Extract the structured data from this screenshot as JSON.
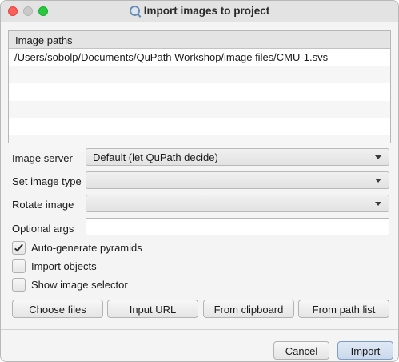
{
  "window": {
    "title": "Import images to project"
  },
  "image_paths": {
    "header": "Image paths",
    "rows": [
      "/Users/sobolp/Documents/QuPath Workshop/image files/CMU-1.svs",
      "",
      "",
      "",
      "",
      ""
    ]
  },
  "form": {
    "image_server": {
      "label": "Image server",
      "value": "Default (let QuPath decide)"
    },
    "image_type": {
      "label": "Set image type",
      "value": ""
    },
    "rotate": {
      "label": "Rotate image",
      "value": ""
    },
    "optional_args": {
      "label": "Optional args",
      "value": ""
    }
  },
  "options": {
    "pyramids": {
      "label": "Auto-generate pyramids",
      "checked": true
    },
    "objects": {
      "label": "Import objects",
      "checked": false
    },
    "selector": {
      "label": "Show image selector",
      "checked": false
    }
  },
  "actions": {
    "choose_files": "Choose files",
    "input_url": "Input URL",
    "from_clipboard": "From clipboard",
    "from_path_list": "From path list"
  },
  "footer": {
    "cancel": "Cancel",
    "import": "Import"
  },
  "colors": {
    "close": "#fe5f57",
    "minimize": "#c9c9c9",
    "maximize": "#28c940",
    "primary_button": "#c9d9ec"
  },
  "icons": {
    "title": "search-icon",
    "dropdown": "chevron-down-icon",
    "check": "checkmark-icon"
  }
}
